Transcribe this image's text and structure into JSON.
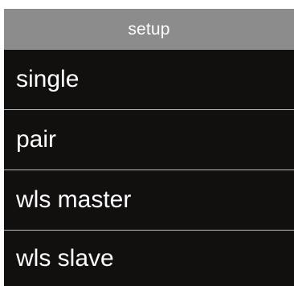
{
  "header": {
    "title": "setup"
  },
  "menu": {
    "items": [
      {
        "label": "single"
      },
      {
        "label": "pair"
      },
      {
        "label": "wls master"
      },
      {
        "label": "wls slave"
      }
    ]
  },
  "colors": {
    "header_bg": "#8c8c8c",
    "menu_bg": "#120f0f",
    "text": "#ffffff",
    "divider": "#bdbdbd"
  }
}
